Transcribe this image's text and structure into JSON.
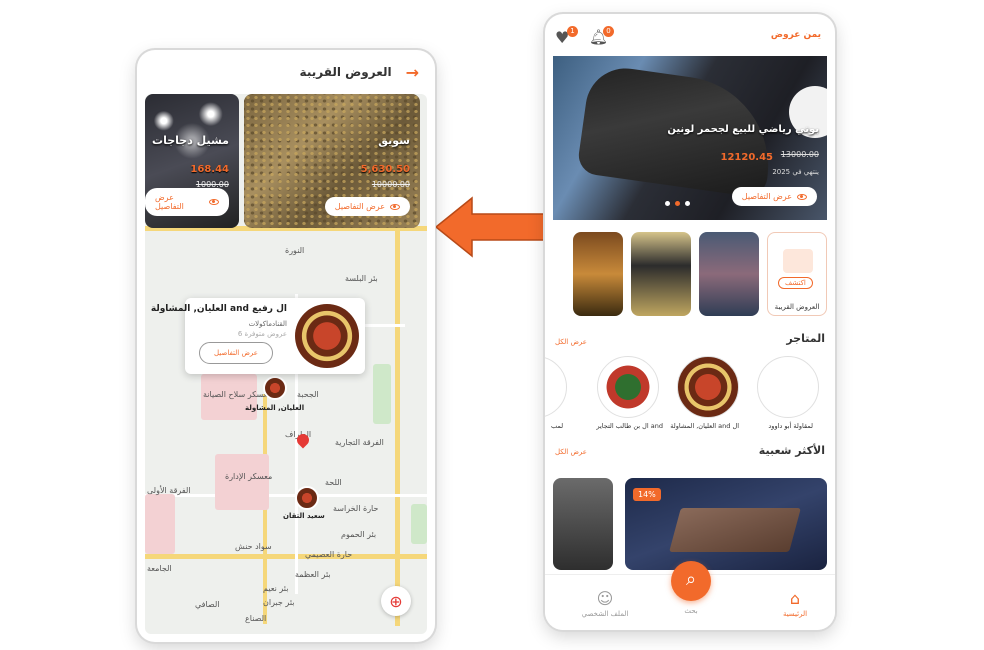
{
  "left_phone": {
    "title": "العروض القريبة",
    "offers": [
      {
        "name": "سويق",
        "price": "5,630.50",
        "old_price": "10000.00",
        "details": "عرض التفاصيل"
      },
      {
        "name": "مشيل دجاجات",
        "price": "168.44",
        "old_price": "1000.00",
        "details": "عرض التفاصيل"
      }
    ],
    "popup": {
      "name": "العليان, المشاولة and ال رفيع",
      "category": "القنادماكولات",
      "count": "6 عروض متوفرة",
      "details": "عرض التفاصيل"
    },
    "map_labels": [
      "النورة",
      "بئر البلسة",
      "الجحبة",
      "معسكر سلاح الصيانة",
      "الطراف",
      "الفرقة التجارية",
      "معسكر الإدارة",
      "اللحة",
      "حارة الخراسة",
      "بئر الحموم",
      "سواد حنش",
      "حارة العصيمي",
      "بئر العظمة",
      "بئر نعيم",
      "بئر جبران",
      "الصافي",
      "الجامعة",
      "الصناع",
      "الفرقة الأولى"
    ],
    "markers": [
      {
        "label": "العليان, المشاولة"
      },
      {
        "label": "سعيد التقان"
      }
    ]
  },
  "right_phone": {
    "brand": "يمن عروض",
    "heart_badge": "1",
    "bell_badge": "0",
    "banner": {
      "title": "بوتي رياضي للبيع لجحمر لونين",
      "price": "12120.45",
      "old_price": "13000.00",
      "date": "2025 ينتهي في",
      "details": "عرض التفاصيل"
    },
    "categories": [
      {
        "label": "العروض القريبة",
        "button": "اكتشف"
      },
      {
        "label": ""
      },
      {
        "label": ""
      },
      {
        "label": ""
      }
    ],
    "stores_section": {
      "title": "المتاجر",
      "link": "عرض الكل"
    },
    "stores": [
      {
        "label": "لمقاولة أبو داوود"
      },
      {
        "label": "العليان, المشاولة and ال"
      },
      {
        "label": "ال بن طالب التجاير and"
      },
      {
        "label": "لمب"
      }
    ],
    "popular_section": {
      "title": "الأكثر شعبية",
      "link": "عرض الكل"
    },
    "products": [
      {
        "discount": "14%"
      }
    ],
    "nav": {
      "home": "الرئيسية",
      "search": "بحث",
      "profile": "الملف الشخصي"
    }
  },
  "colors": {
    "accent": "#f26a2b"
  }
}
